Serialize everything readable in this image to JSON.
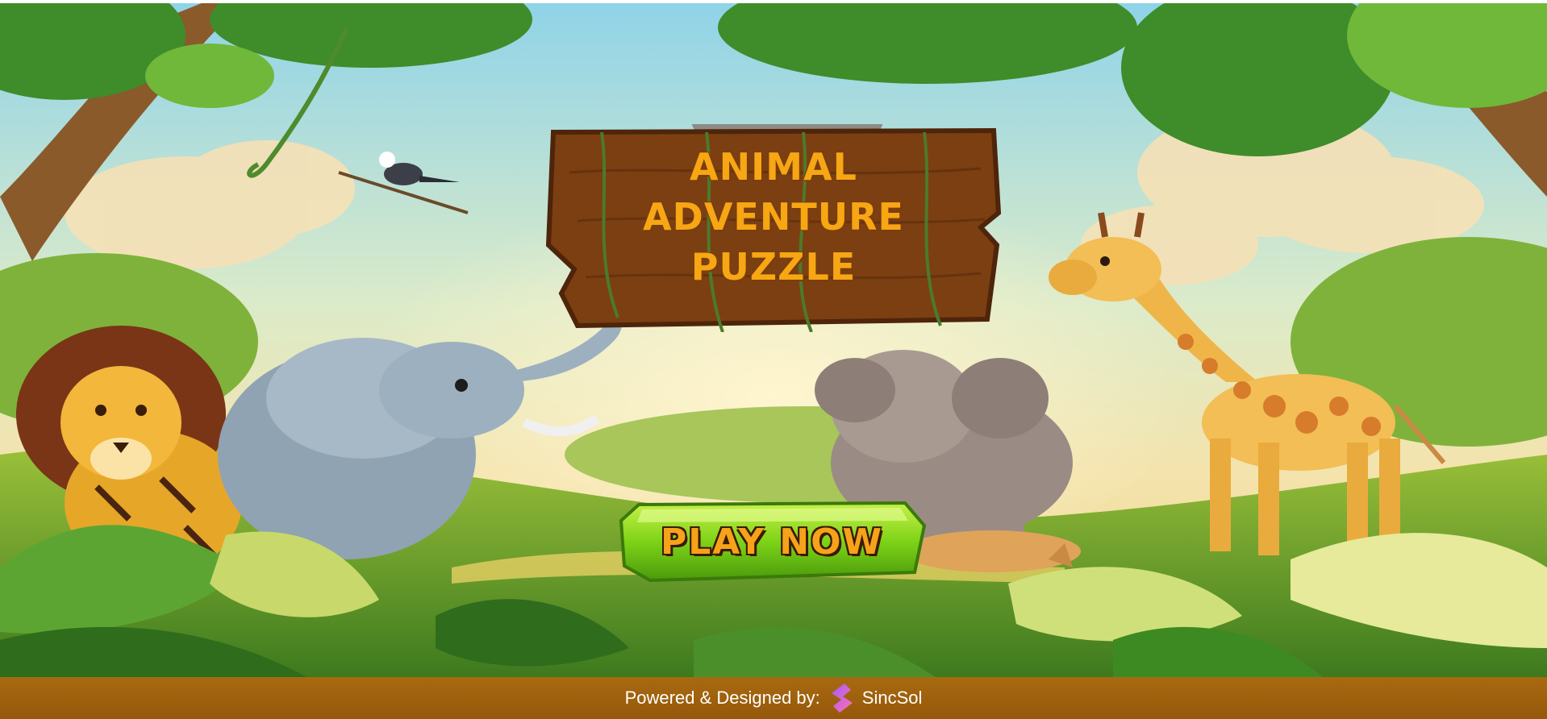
{
  "title": {
    "lines": [
      "ANIMAL",
      "ADVENTURE",
      "PUZZLE"
    ]
  },
  "play_button": {
    "label": "PLAY NOW"
  },
  "footer": {
    "powered_text": "Powered & Designed by:",
    "brand_name": "SincSol",
    "brand_icon": "sincsol-logo-icon"
  },
  "colors": {
    "title_text": "#f7a614",
    "sign_wood": "#7b3f12",
    "button_green": "#7ed317",
    "footer_bg": "#a0620d"
  },
  "illustration": {
    "animals": [
      "lion",
      "elephant",
      "baby-elephant",
      "giraffe",
      "anteater",
      "bird"
    ]
  }
}
